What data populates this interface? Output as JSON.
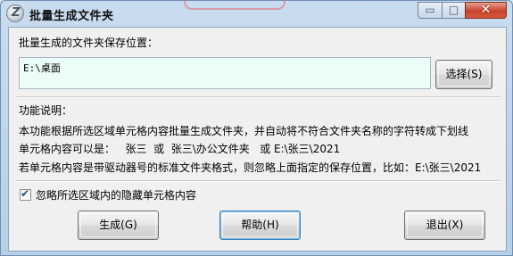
{
  "window": {
    "title": "批量生成文件夹",
    "minimize_glyph": "▭",
    "maximize_glyph": "□",
    "close_glyph": "✕",
    "app_icon_glyph": "Z"
  },
  "location": {
    "label": "批量生成的文件夹保存位置：",
    "path_value": "E:\\桌面",
    "browse_button": "选择(S)"
  },
  "help": {
    "heading": "功能说明：",
    "line1": "本功能根据所选区域单元格内容批量生成文件夹，并自动将不符合文件夹名称的字符转成下划线",
    "line2": "单元格内容可以是：   张三  或  张三\\办公文件夹   或 E:\\张三\\2021",
    "line3": "若单元格内容是带驱动器号的标准文件夹格式，则忽略上面指定的保存位置，比如：E:\\张三\\2021"
  },
  "options": {
    "ignore_hidden_label": "忽略所选区域内的隐藏单元格内容",
    "ignore_hidden_checked": true,
    "check_glyph": "✔"
  },
  "buttons": {
    "generate": "生成(G)",
    "help": "帮助(H)",
    "exit": "退出(X)"
  }
}
